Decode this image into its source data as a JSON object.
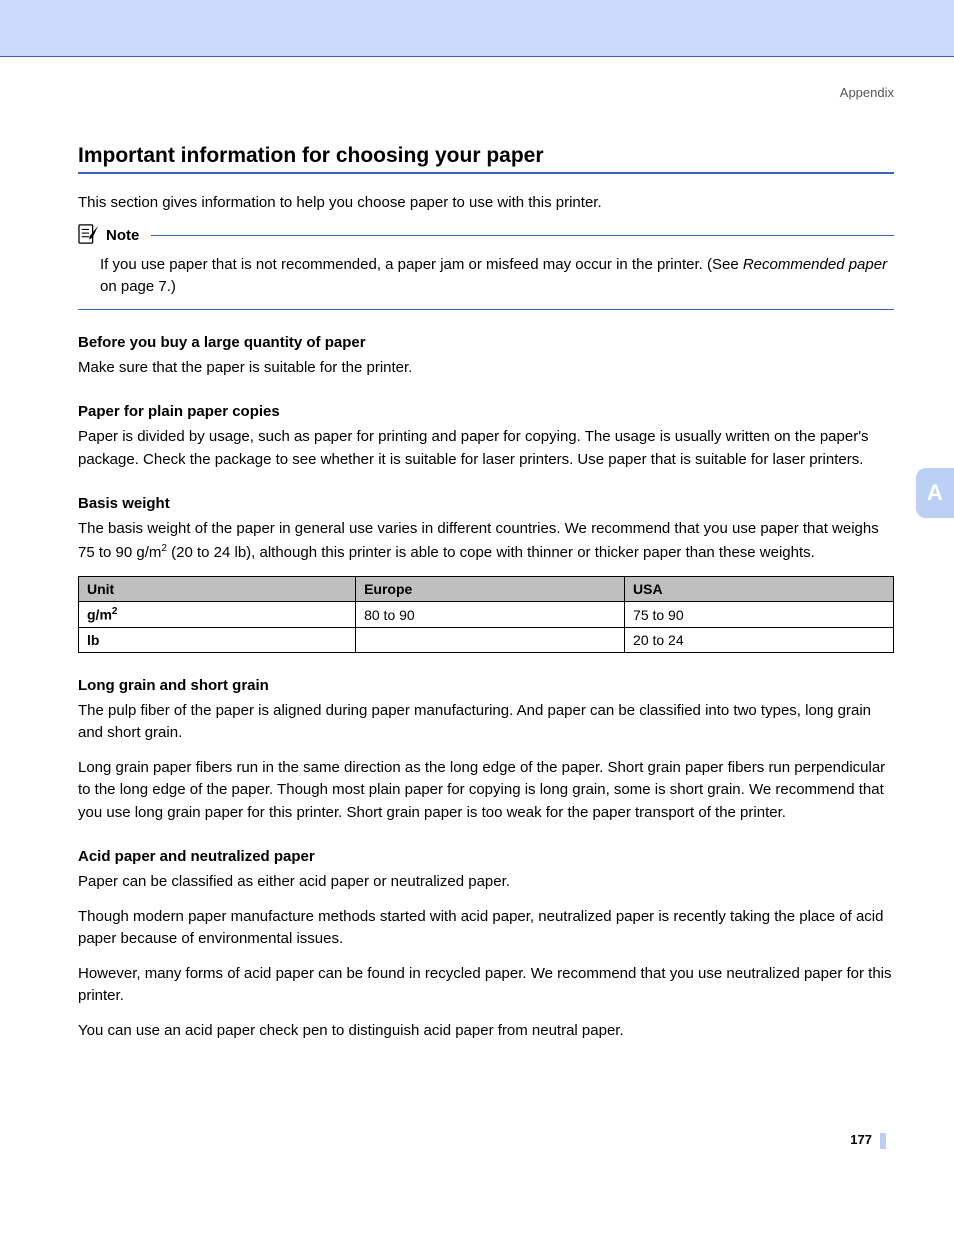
{
  "breadcrumb": "Appendix",
  "title": "Important information for choosing your paper",
  "intro": "This section gives information to help you choose paper to use with this printer.",
  "note": {
    "label": "Note",
    "text_before": "If you use paper that is not recommended, a paper jam or misfeed may occur in the printer. (See ",
    "ref": "Recommended paper",
    "text_after": " on page 7.)"
  },
  "sections": {
    "before_buy": {
      "heading": "Before you buy a large quantity of paper",
      "p1": "Make sure that the paper is suitable for the printer."
    },
    "plain_copies": {
      "heading": "Paper for plain paper copies",
      "p1": "Paper is divided by usage, such as paper for printing and paper for copying. The usage is usually written on the paper's package. Check the package to see whether it is suitable for laser printers. Use paper that is suitable for laser printers."
    },
    "basis_weight": {
      "heading": "Basis weight",
      "p1_a": "The basis weight of the paper in general use varies in different countries. We recommend that you use paper that weighs 75 to 90 g/m",
      "p1_b": " (20 to 24 lb), although this printer is able to cope with thinner or thicker paper than these weights."
    },
    "grain": {
      "heading": "Long grain and short grain",
      "p1": "The pulp fiber of the paper is aligned during paper manufacturing. And paper can be classified into two types, long grain and short grain.",
      "p2": "Long grain paper fibers run in the same direction as the long edge of the paper. Short grain paper fibers run perpendicular to the long edge of the paper. Though most plain paper for copying is long grain, some is short grain. We recommend that you use long grain paper for this printer. Short grain paper is too weak for the paper transport of the printer."
    },
    "acid": {
      "heading": "Acid paper and neutralized paper",
      "p1": "Paper can be classified as either acid paper or neutralized paper.",
      "p2": "Though modern paper manufacture methods started with acid paper, neutralized paper is recently taking the place of acid paper because of environmental issues.",
      "p3": "However, many forms of acid paper can be found in recycled paper. We recommend that you use neutralized paper for this printer.",
      "p4": "You can use an acid paper check pen to distinguish acid paper from neutral paper."
    }
  },
  "table": {
    "headers": {
      "unit": "Unit",
      "europe": "Europe",
      "usa": "USA"
    },
    "rows": [
      {
        "unit_a": "g/m",
        "unit_sup": "2",
        "europe": "80 to 90",
        "usa": "75 to 90"
      },
      {
        "unit_a": "lb",
        "unit_sup": "",
        "europe": "",
        "usa": "20 to 24"
      }
    ]
  },
  "side_tab": "A",
  "page_number": "177"
}
